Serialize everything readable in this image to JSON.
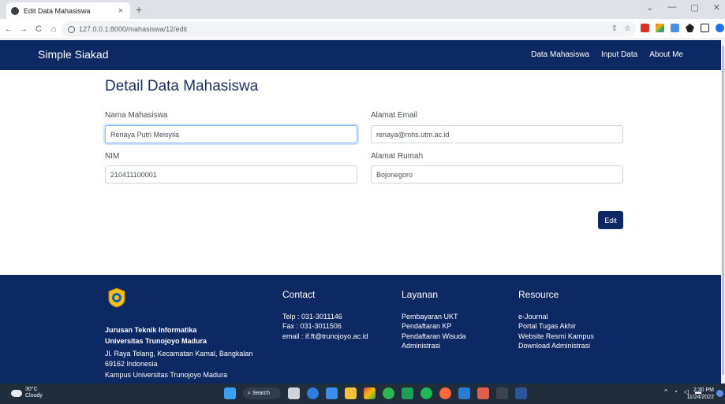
{
  "browser": {
    "tab_title": "Edit Data Mahasiswa",
    "tab_close": "×",
    "new_tab": "+",
    "url": "127.0.0.1:8000/mahasiswa/12/edit",
    "win_min": "—",
    "win_max": "▢",
    "win_close": "✕",
    "win_dropdown": "⌄"
  },
  "navbar": {
    "brand": "Simple Siakad",
    "links": [
      "Data Mahasiswa",
      "Input Data",
      "About Me"
    ]
  },
  "form": {
    "title": "Detail Data Mahasiswa",
    "nama_label": "Nama Mahasiswa",
    "nama_value": "Renaya Putri Meisyila",
    "email_label": "Alamat Email",
    "email_value": "renaya@mhs.utm.ac.id",
    "nim_label": "NIM",
    "nim_value": "210411100001",
    "alamat_label": "Alamat Rumah",
    "alamat_value": "Bojonegoro",
    "edit_label": "Edit"
  },
  "footer": {
    "org_line1": "Jurusan Teknik Informatika",
    "org_line2": "Universitas Trunojoyo Madura",
    "addr_line1": "Jl. Raya Telang, Kecamatan Kamal, Bangkalan",
    "addr_line2": "69162 Indonesia",
    "addr_line3": "Kampus Universitas Trunojoyo Madura",
    "contact_title": "Contact",
    "contact_items": [
      "Telp : 031-3011146",
      "Fax : 031-3011506",
      "email : if.ft@trunojoyo.ac.id"
    ],
    "layanan_title": "Layanan",
    "layanan_items": [
      "Pembayaran UKT",
      "Pendaftaran KP",
      "Pendaftaran Wisuda",
      "Administrasi"
    ],
    "resource_title": "Resource",
    "resource_items": [
      "e-Journal",
      "Portal Tugas Akhir",
      "Website Resmi Kampus",
      "Download Administrasi"
    ]
  },
  "taskbar": {
    "temp": "30°C",
    "weather": "Cloudy",
    "search": "Search",
    "time": "2:30 PM",
    "date": "11/24/2022"
  },
  "colors": {
    "navy": "#0c2963",
    "logo_yellow": "#f2c21b"
  }
}
